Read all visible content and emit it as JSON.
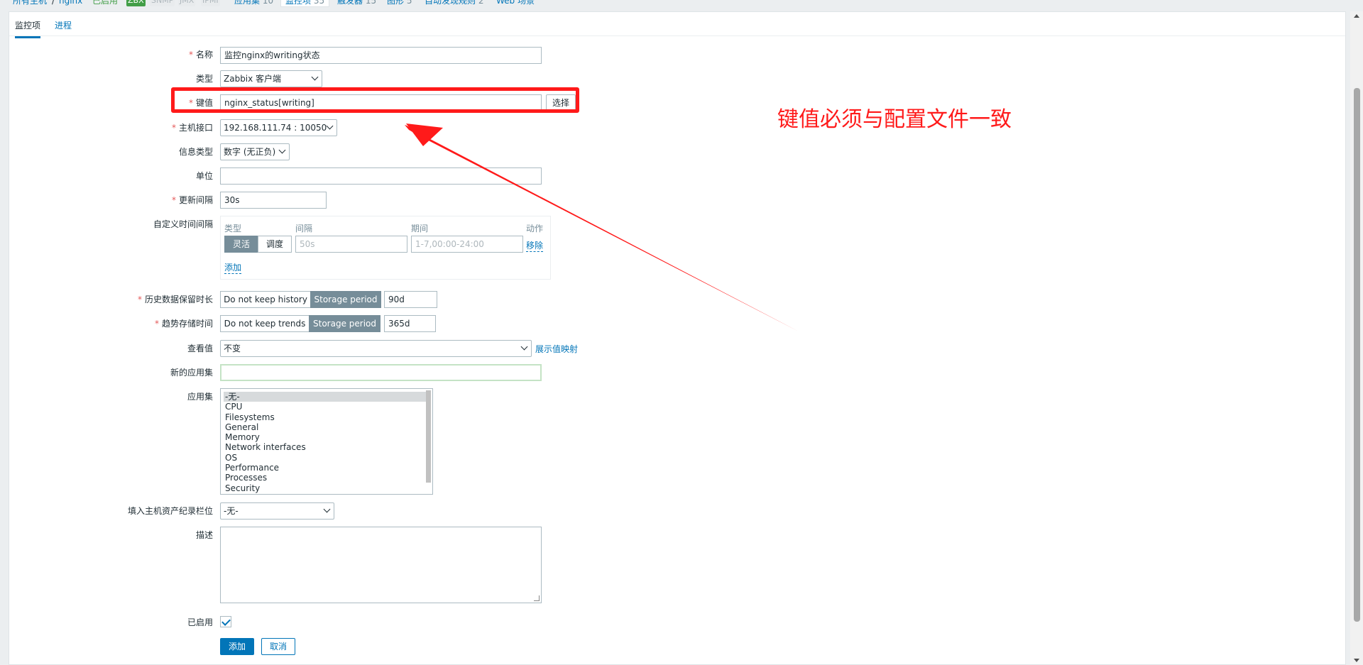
{
  "breadcrumb": {
    "all_hosts": "所有主机",
    "separator": "/",
    "host": "nginx",
    "status": "已启用",
    "availability": [
      "ZBX",
      "SNMP",
      "JMX",
      "IPMI"
    ],
    "tabs": [
      {
        "label": "应用集",
        "count": "10"
      },
      {
        "label": "监控项",
        "count": "35"
      },
      {
        "label": "触发器",
        "count": "15"
      },
      {
        "label": "图形",
        "count": "5"
      },
      {
        "label": "自动发现规则",
        "count": "2"
      },
      {
        "label": "Web 场景",
        "count": ""
      }
    ]
  },
  "subtabs": [
    "监控项",
    "进程"
  ],
  "form": {
    "name": {
      "label": "名称",
      "value": "监控nginx的writing状态"
    },
    "type": {
      "label": "类型",
      "value": "Zabbix 客户端"
    },
    "key": {
      "label": "键值",
      "value": "nginx_status[writing]",
      "select_button": "选择"
    },
    "interface": {
      "label": "主机接口",
      "value": "192.168.111.74 : 10050"
    },
    "info_type": {
      "label": "信息类型",
      "value": "数字 (无正负)"
    },
    "units": {
      "label": "单位",
      "value": ""
    },
    "update_interval": {
      "label": "更新间隔",
      "value": "30s"
    },
    "custom_intervals": {
      "label": "自定义时间间隔",
      "headers": [
        "类型",
        "间隔",
        "期间",
        "动作"
      ],
      "row": {
        "types": [
          "灵活",
          "调度"
        ],
        "interval_placeholder": "50s",
        "period_placeholder": "1-7,00:00-24:00",
        "remove": "移除"
      },
      "add": "添加"
    },
    "history": {
      "label": "历史数据保留时长",
      "options": [
        "Do not keep history",
        "Storage period"
      ],
      "value": "90d"
    },
    "trends": {
      "label": "趋势存储时间",
      "options": [
        "Do not keep trends",
        "Storage period"
      ],
      "value": "365d"
    },
    "show_value": {
      "label": "查看值",
      "value": "不变",
      "link": "展示值映射"
    },
    "new_application": {
      "label": "新的应用集",
      "value": ""
    },
    "applications": {
      "label": "应用集",
      "items": [
        "-无-",
        "CPU",
        "Filesystems",
        "General",
        "Memory",
        "Network interfaces",
        "OS",
        "Performance",
        "Processes",
        "Security"
      ]
    },
    "inventory": {
      "label": "填入主机资产纪录栏位",
      "value": "-无-"
    },
    "description": {
      "label": "描述",
      "value": ""
    },
    "enabled": {
      "label": "已启用",
      "checked": true
    },
    "buttons": {
      "add": "添加",
      "cancel": "取消"
    }
  },
  "annotation": {
    "text": "键值必须与配置文件一致",
    "color": "#ff1a1a"
  }
}
